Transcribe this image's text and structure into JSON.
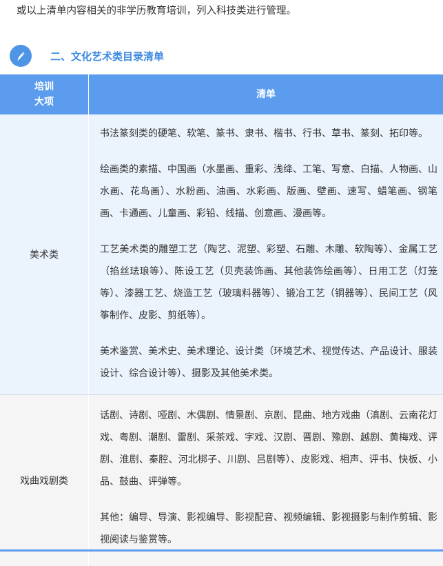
{
  "intro_text": "或以上清单内容相关的非学历教育培训，列入科技类进行管理。",
  "section": {
    "icon": "pencil-icon",
    "accent": "#4f95e6",
    "title": "二、文化艺术类目录清单"
  },
  "table": {
    "header": {
      "category_line1": "培训",
      "category_line2": "大项",
      "list": "清单",
      "bg": "#5b9cef"
    },
    "rows": [
      {
        "category": "美术类",
        "paragraphs": [
          "书法篆刻类的硬笔、软笔、篆书、隶书、楷书、行书、草书、篆刻、拓印等。",
          "绘画类的素描、中国画（水墨画、重彩、浅绛、工笔、写意、白描、人物画、山水画、花鸟画）、水粉画、油画、水彩画、版画、壁画、速写、蜡笔画、钢笔画、卡通画、儿童画、彩铅、线描、创意画、漫画等。",
          "工艺美术类的雕塑工艺（陶艺、泥塑、彩塑、石雕、木雕、软陶等）、金属工艺（掐丝珐琅等）、陈设工艺（贝壳装饰画、其他装饰绘画等）、日用工艺（灯笼等）、漆器工艺、烧造工艺（玻璃料器等）、锻冶工艺（铜器等）、民间工艺（风筝制作、皮影、剪纸等）。",
          "美术鉴赏、美术史、美术理论、设计类（环境艺术、视觉传达、产品设计、服装设计、综合设计等）、摄影及其他美术类。"
        ]
      },
      {
        "category": "戏曲戏剧类",
        "paragraphs": [
          "话剧、诗剧、哑剧、木偶剧、情景剧、京剧、昆曲、地方戏曲（滇剧、云南花灯戏、粤剧、潮剧、雷剧、采茶戏、字戏、汉剧、晋剧、豫剧、越剧、黄梅戏、评剧、淮剧、秦腔、河北梆子、川剧、吕剧等）、皮影戏、相声、评书、快板、小品、鼓曲、评弹等。",
          "其他：编导、导演、影视编导、影视配音、视频编辑、影视摄影与制作剪辑、影视阅读与鉴赏等。"
        ]
      }
    ]
  }
}
